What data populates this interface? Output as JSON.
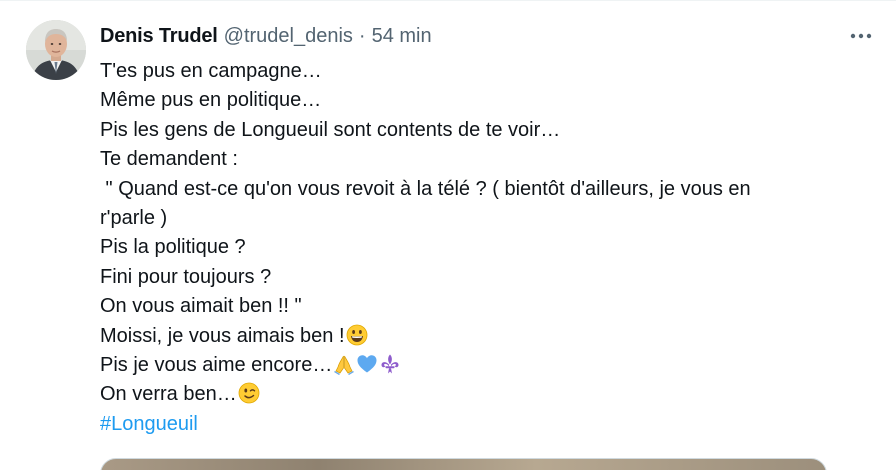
{
  "author": {
    "display_name": "Denis Trudel",
    "handle": "@trudel_denis",
    "separator": "·",
    "timestamp": "54 min"
  },
  "more_icon": "more-horizontal-icon",
  "tweet": {
    "lines": [
      "T'es pus en campagne…",
      "Même pus en politique…",
      "Pis les gens de Longueuil sont contents de te voir…",
      "Te demandent :",
      " \" Quand est-ce qu'on vous revoit à la télé ? ( bientôt d'ailleurs, je vous en",
      "r'parle )",
      "Pis la politique ?",
      "Fini pour toujours ?",
      "On vous aimait ben !! \"",
      "Moissi, je vous aimais ben !",
      "Pis je vous aime encore…",
      "On verra ben…"
    ],
    "emojis": {
      "line_9": [
        "grinning-face-emoji"
      ],
      "line_10": [
        "folded-hands-emoji",
        "blue-heart-emoji",
        "fleur-de-lis-emoji"
      ],
      "line_11": [
        "winking-face-emoji"
      ]
    },
    "hashtag": "#Longueuil"
  },
  "colors": {
    "text": "#0f1419",
    "secondary": "#536471",
    "link": "#1d9bf0",
    "border": "#cfd9de"
  }
}
